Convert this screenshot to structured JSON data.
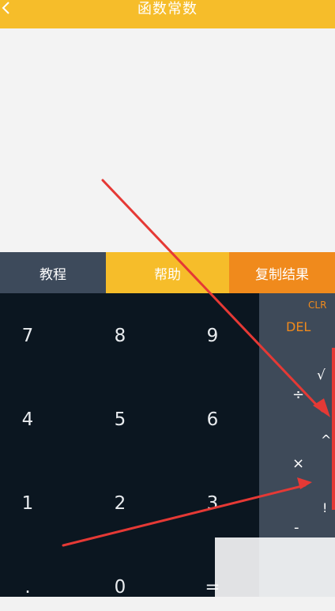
{
  "header": {
    "title": "函数常数",
    "back_icon": "chevron-left-icon"
  },
  "tabs": [
    {
      "label": "教程"
    },
    {
      "label": "帮助"
    },
    {
      "label": "复制结果"
    }
  ],
  "keypad": {
    "keys": [
      "7",
      "8",
      "9",
      "4",
      "5",
      "6",
      "1",
      "2",
      "3",
      ".",
      "0",
      "="
    ]
  },
  "side_panel": {
    "clr": "CLR",
    "del": "DEL",
    "ops": [
      "√",
      "÷",
      "^",
      "×",
      "!",
      "-"
    ]
  },
  "colors": {
    "header": "#f6bd2a",
    "tab_tutorial": "#3d4a5b",
    "tab_help": "#f6bd2a",
    "tab_copy": "#f08a1c",
    "keypad_bg": "#0b1620",
    "side_bg": "#3e4a59",
    "annotation_arrow": "#e53935"
  }
}
